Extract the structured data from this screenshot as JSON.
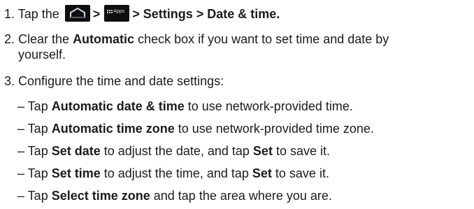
{
  "step1": {
    "prefix": "1. Tap  the",
    "sep1": ">",
    "apps_label": "Apps",
    "path": "> Settings > Date & time."
  },
  "step2": {
    "prefix": "2. Clear  the ",
    "bold": "Automatic",
    "rest": " check box if you want to set time and date by",
    "cont": "yourself."
  },
  "step3": {
    "text": "3.  Configure the time and date settings:"
  },
  "bullets": [
    {
      "dash": "– Tap ",
      "bold": "Automatic date & time",
      "rest": " to use network-provided time."
    },
    {
      "dash": "– Tap ",
      "bold": "Automatic time zone",
      "rest": " to use network-provided time zone."
    },
    {
      "dash": "– Tap ",
      "bold": "Set date",
      "mid": " to adjust the date, and tap ",
      "bold2": "Set",
      "rest": " to save it."
    },
    {
      "dash": "– Tap ",
      "bold": "Set time",
      "mid": " to adjust the time, and tap ",
      "bold2": "Set",
      "rest": " to save it."
    },
    {
      "dash": "– Tap ",
      "bold": "Select time zone",
      "rest": " and tap the area where you are."
    }
  ]
}
